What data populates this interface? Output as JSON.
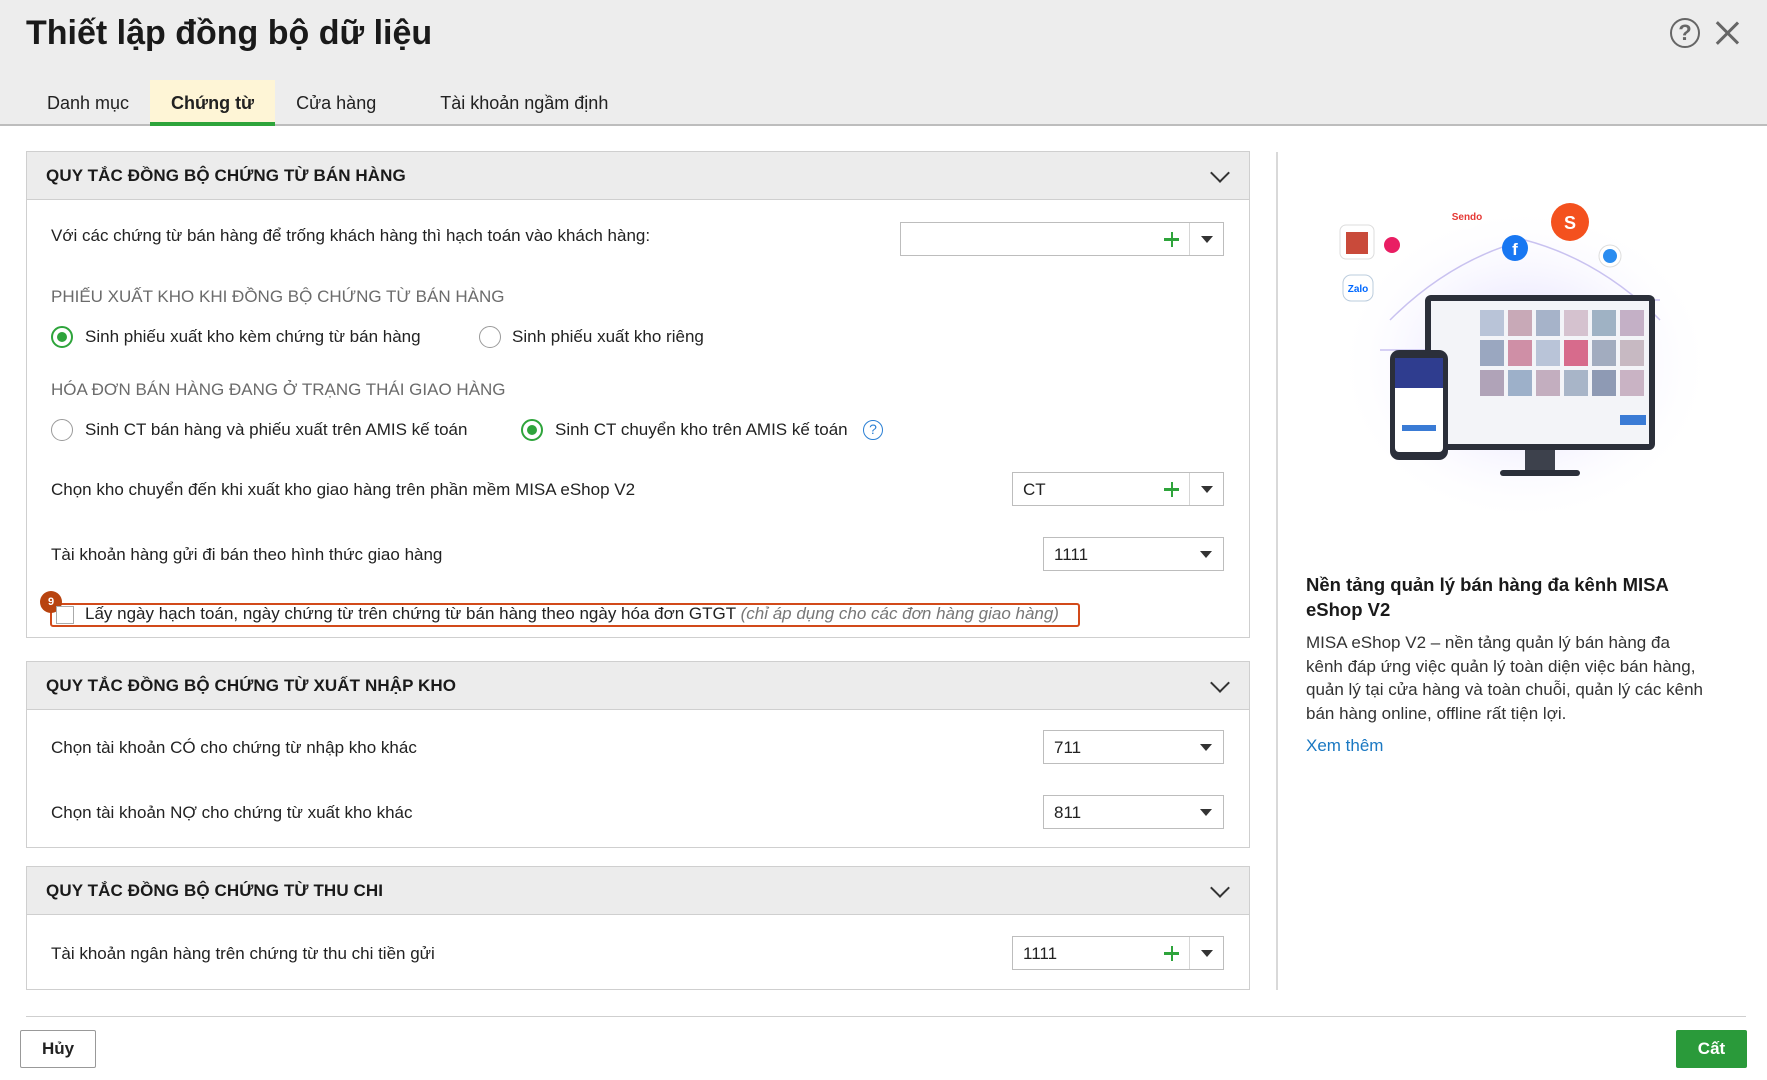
{
  "dialog": {
    "title": "Thiết lập đồng bộ dữ liệu",
    "help_icon": "question-circle-icon",
    "close_icon": "close-icon"
  },
  "tabs": [
    {
      "label": "Danh mục",
      "active": false
    },
    {
      "label": "Chứng từ",
      "active": true
    },
    {
      "label": "Cửa hàng",
      "active": false
    },
    {
      "label": "Tài khoản ngầm định",
      "active": false
    }
  ],
  "sales_section": {
    "title": "QUY TẮC ĐỒNG BỘ CHỨNG TỪ BÁN HÀNG",
    "empty_customer_label": "Với các chứng từ bán hàng để trống khách hàng thì hạch toán vào khách hàng:",
    "empty_customer_value": "",
    "issue_note_heading": "PHIẾU XUẤT KHO KHI ĐỒNG BỘ CHỨNG TỪ BÁN HÀNG",
    "issue_note_options": [
      {
        "label": "Sinh phiếu xuất kho kèm chứng từ bán hàng",
        "selected": true
      },
      {
        "label": "Sinh phiếu xuất kho riêng",
        "selected": false
      }
    ],
    "delivery_heading": "HÓA ĐƠN BÁN HÀNG ĐANG Ở TRẠNG THÁI GIAO HÀNG",
    "delivery_options": [
      {
        "label": "Sinh CT bán hàng và phiếu xuất trên AMIS kế toán",
        "selected": false
      },
      {
        "label": "Sinh CT chuyển kho trên AMIS kế toán",
        "selected": true
      }
    ],
    "info_icon": "question-circle-icon",
    "transfer_warehouse_label": "Chọn kho chuyển đến khi xuất kho giao hàng trên phần mềm MISA eShop V2",
    "transfer_warehouse_value": "CT",
    "consign_account_label": "Tài khoản hàng gửi đi bán theo hình thức giao hàng",
    "consign_account_value": "1111",
    "badge_number": "9",
    "date_checkbox_label": "Lấy ngày hạch toán, ngày chứng từ trên chứng từ bán hàng theo ngày hóa đơn GTGT",
    "date_checkbox_note": "(chỉ áp dụng cho các đơn hàng giao hàng)",
    "date_checkbox_checked": false
  },
  "warehouse_section": {
    "title": "QUY TẮC ĐỒNG BỘ CHỨNG TỪ XUẤT NHẬP KHO",
    "credit_label": "Chọn tài khoản CÓ cho chứng từ nhập kho khác",
    "credit_value": "711",
    "debit_label": "Chọn tài khoản NỢ cho chứng từ xuất kho khác",
    "debit_value": "811"
  },
  "cash_section": {
    "title": "QUY TẮC ĐỒNG BỘ CHỨNG TỪ THU CHI",
    "bank_label": "Tài khoản ngân hàng trên chứng từ thu chi tiền gửi",
    "bank_value": "1111"
  },
  "promo": {
    "title": "Nền tảng quản lý bán hàng đa kênh MISA eShop V2",
    "description": "MISA eShop V2 – nền tảng quản lý bán hàng đa kênh đáp ứng việc quản lý toàn diện việc bán hàng, quản lý tại cửa hàng và toàn chuỗi, quản lý các kênh bán hàng online, offline rất tiện lợi.",
    "link": "Xem thêm",
    "illustration_labels": [
      "Sendo",
      "Shopee",
      "Zalo"
    ]
  },
  "footer": {
    "cancel_label": "Hủy",
    "save_label": "Cất"
  },
  "colors": {
    "accent_green": "#2ea43b",
    "active_tab_bg": "#fef5d6",
    "highlight_border": "#d24a1a",
    "link_blue": "#1a78c2"
  }
}
